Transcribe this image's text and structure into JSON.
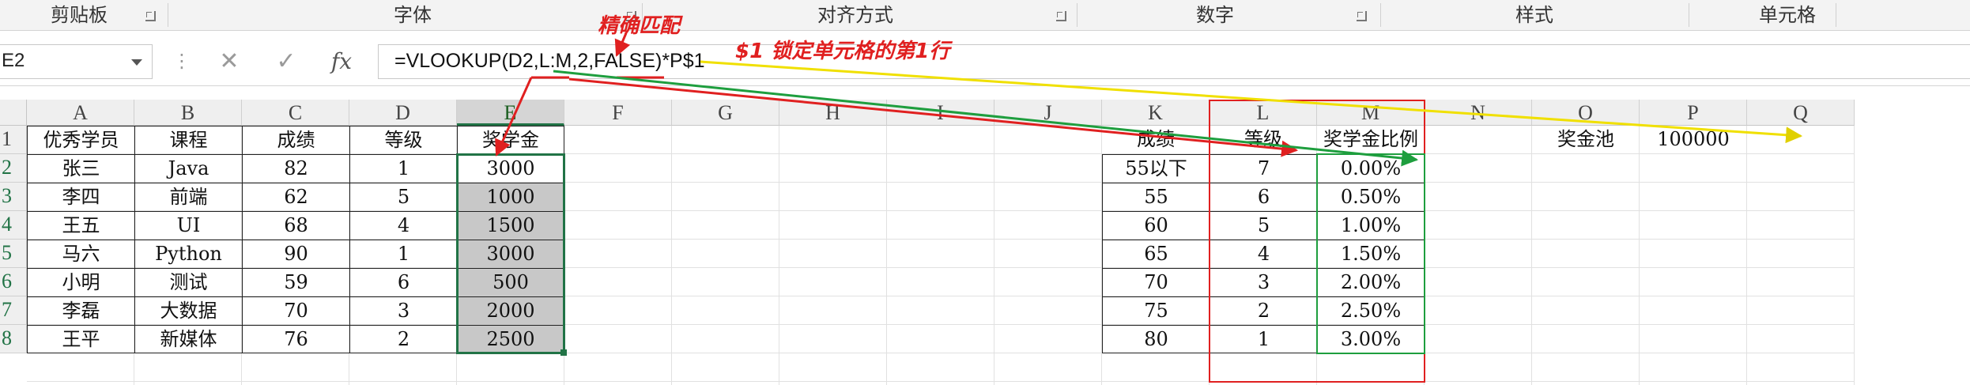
{
  "ribbon": {
    "groups": [
      {
        "label": "剪贴板",
        "launcher": true
      },
      {
        "label": "字体",
        "launcher": true
      },
      {
        "label": "对齐方式",
        "launcher": true
      },
      {
        "label": "数字",
        "launcher": true
      },
      {
        "label": "样式",
        "launcher": false
      },
      {
        "label": "单元格",
        "launcher": false
      }
    ]
  },
  "formula_bar": {
    "name_box": "E2",
    "cancel_icon": "close-icon",
    "enter_icon": "check-icon",
    "fx_label": "fx",
    "formula": "=VLOOKUP(D2,L:M,2,FALSE)*P$1"
  },
  "annotations": {
    "exact_match": "精确匹配",
    "lock_row": "$1 锁定单元格的第1行"
  },
  "columns": [
    "A",
    "B",
    "C",
    "D",
    "E",
    "F",
    "G",
    "H",
    "I",
    "J",
    "K",
    "L",
    "M",
    "N",
    "O",
    "P",
    "Q"
  ],
  "rows": [
    "1",
    "2",
    "3",
    "4",
    "5",
    "6",
    "7",
    "8"
  ],
  "table1": {
    "headers": [
      "优秀学员",
      "课程",
      "成绩",
      "等级",
      "奖学金"
    ],
    "rows": [
      [
        "张三",
        "Java",
        "82",
        "1",
        "3000"
      ],
      [
        "李四",
        "前端",
        "62",
        "5",
        "1000"
      ],
      [
        "王五",
        "UI",
        "68",
        "4",
        "1500"
      ],
      [
        "马六",
        "Python",
        "90",
        "1",
        "3000"
      ],
      [
        "小明",
        "测试",
        "59",
        "6",
        "500"
      ],
      [
        "李磊",
        "大数据",
        "70",
        "3",
        "2000"
      ],
      [
        "王平",
        "新媒体",
        "76",
        "2",
        "2500"
      ]
    ]
  },
  "table2": {
    "headers": [
      "成绩",
      "等级",
      "奖学金比例"
    ],
    "rows": [
      [
        "55以下",
        "7",
        "0.00%"
      ],
      [
        "55",
        "6",
        "0.50%"
      ],
      [
        "60",
        "5",
        "1.00%"
      ],
      [
        "65",
        "4",
        "1.50%"
      ],
      [
        "70",
        "3",
        "2.00%"
      ],
      [
        "75",
        "2",
        "2.50%"
      ],
      [
        "80",
        "1",
        "3.00%"
      ]
    ]
  },
  "pool": {
    "label": "奖金池",
    "value": "100000"
  },
  "colors": {
    "red": "#e02020",
    "green": "#1e9e3e",
    "yellow": "#f0e000",
    "selection": "#217346"
  }
}
